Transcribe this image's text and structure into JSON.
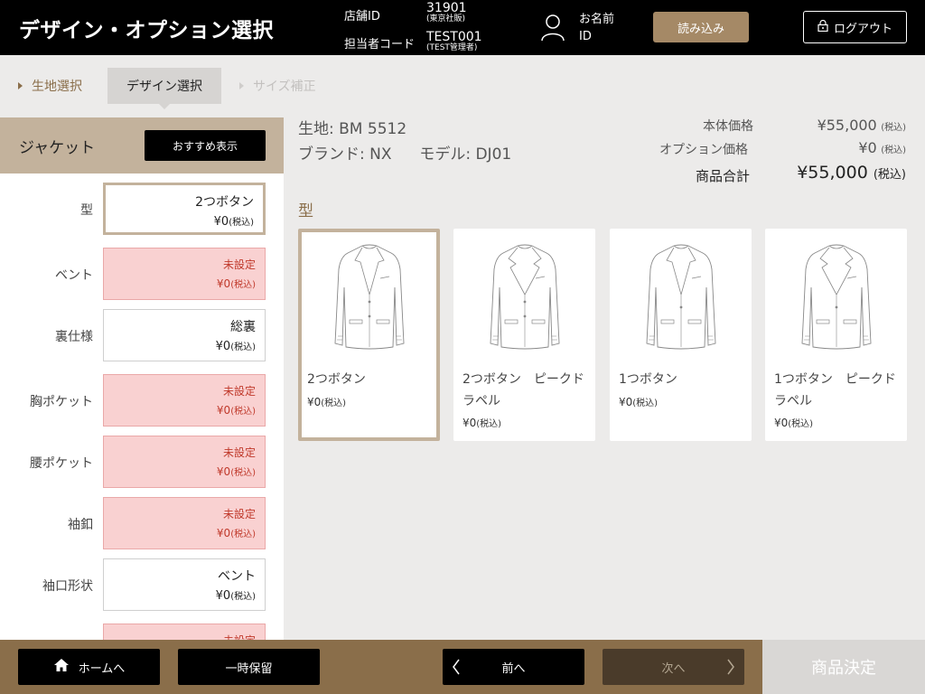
{
  "header": {
    "title": "デザイン・オプション選択",
    "store_id_label": "店舗ID",
    "store_id_value": "31901",
    "store_name": "(東京社販)",
    "staff_code_label": "担当者コード",
    "staff_code_value": "TEST001",
    "staff_name": "(TEST管理者)",
    "customer_name_label": "お名前",
    "customer_id_label": "ID",
    "load_label": "読み込み",
    "logout_label": "ログアウト"
  },
  "breadcrumb": [
    {
      "label": "生地選択",
      "state": "done"
    },
    {
      "label": "デザイン選択",
      "state": "current"
    },
    {
      "label": "サイズ補正",
      "state": "disabled"
    }
  ],
  "sidebar": {
    "title": "ジャケット",
    "recommend_label": "おすすめ表示",
    "tax_label": "(税込)",
    "options": [
      {
        "label": "型",
        "value": "2つボタン",
        "price": "¥0",
        "status": "selected"
      },
      {
        "label": "ベント",
        "value": "未設定",
        "price": "¥0",
        "status": "unset"
      },
      {
        "label": "裏仕様",
        "value": "総裏",
        "price": "¥0",
        "status": "set"
      },
      {
        "label": "胸ポケット",
        "value": "未設定",
        "price": "¥0",
        "status": "unset"
      },
      {
        "label": "腰ポケット",
        "value": "未設定",
        "price": "¥0",
        "status": "unset"
      },
      {
        "label": "袖釦",
        "value": "未設定",
        "price": "¥0",
        "status": "unset"
      },
      {
        "label": "袖口形状",
        "value": "ベント",
        "price": "¥0",
        "status": "set"
      },
      {
        "label": "",
        "value": "未設定",
        "price": "",
        "status": "unset"
      }
    ]
  },
  "product": {
    "fabric_label": "生地:",
    "fabric_value": "BM 5512",
    "brand_label": "ブランド:",
    "brand_value": "NX",
    "model_label": "モデル:",
    "model_value": "DJ01",
    "base_price_label": "本体価格",
    "base_price_value": "¥55,000",
    "option_price_label": "オプション価格",
    "option_price_value": "¥0",
    "total_label": "商品合計",
    "total_value": "¥55,000",
    "tax_label": "(税込)"
  },
  "section": {
    "title": "型",
    "tax_label": "(税込)",
    "cards": [
      {
        "name": "2つボタン",
        "price": "¥0",
        "selected": true,
        "buttons": 2,
        "peak": false
      },
      {
        "name": "2つボタン　ピークドラペル",
        "price": "¥0",
        "selected": false,
        "buttons": 2,
        "peak": true
      },
      {
        "name": "1つボタン",
        "price": "¥0",
        "selected": false,
        "buttons": 1,
        "peak": false
      },
      {
        "name": "1つボタン　ピークドラペル",
        "price": "¥0",
        "selected": false,
        "buttons": 1,
        "peak": true
      }
    ]
  },
  "footer": {
    "home_label": "ホームへ",
    "hold_label": "一時保留",
    "prev_label": "前へ",
    "next_label": "次へ",
    "decide_label": "商品決定"
  },
  "colors": {
    "header_bg": "#000000",
    "accent": "#a58966",
    "panel_head": "#c3b29c",
    "unset_bg": "#f9d1d1",
    "unset_text": "#c0392b",
    "footer_bg": "#8a6e4a"
  }
}
